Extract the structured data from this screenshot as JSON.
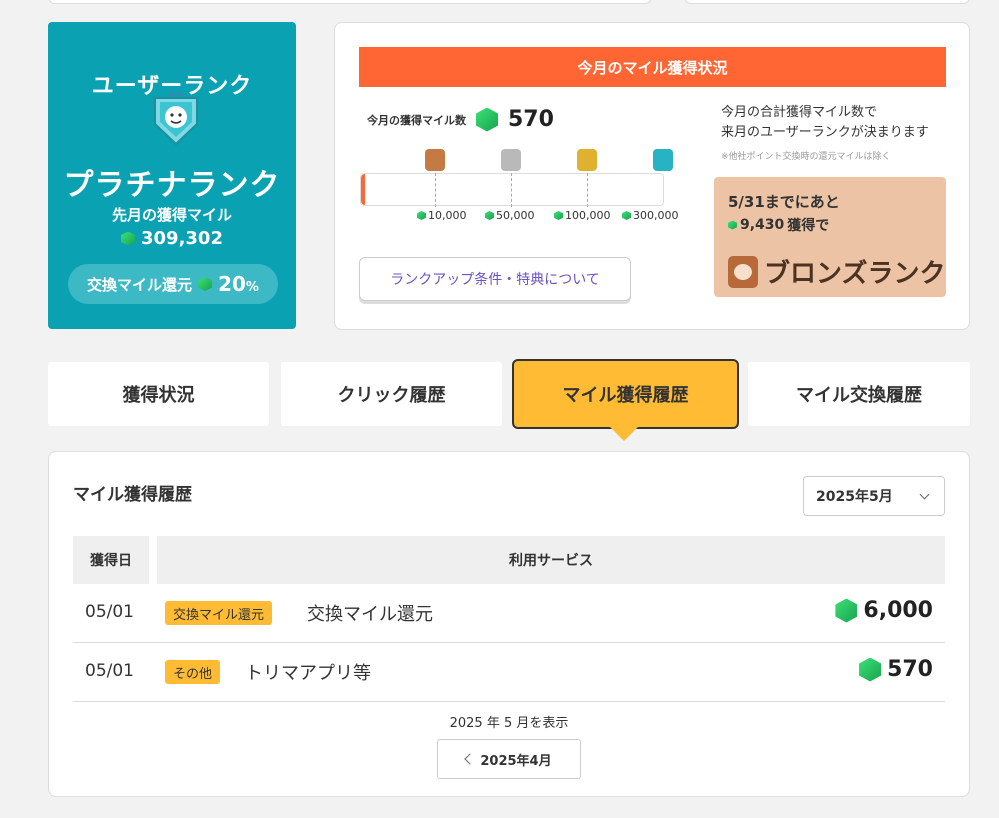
{
  "rank_card": {
    "title": "ユーザーランク",
    "rank_name": "プラチナランク",
    "last_month_label": "先月の獲得マイル",
    "last_month_miles": "309,302",
    "exchange_label": "交換マイル還元",
    "exchange_rate": "20",
    "exchange_unit": "%"
  },
  "status": {
    "header": "今月のマイル獲得状況",
    "current_label": "今月の獲得マイル数",
    "current_miles": "570",
    "progress_fraction": 0.01,
    "thresholds": [
      "10,000",
      "50,000",
      "100,000",
      "300,000"
    ],
    "info_line1": "今月の合計獲得マイル数で",
    "info_line2": "来月のユーザーランクが決まります",
    "note": "※他社ポイント交換時の還元マイルは除く",
    "next_line1": "5/31までにあと",
    "next_miles": "9,430",
    "next_suffix": "獲得で",
    "next_rank": "ブロンズランク",
    "rank_button": "ランクアップ条件・特典について"
  },
  "tabs": [
    {
      "label": "獲得状況"
    },
    {
      "label": "クリック履歴"
    },
    {
      "label": "マイル獲得履歴"
    },
    {
      "label": "マイル交換履歴"
    }
  ],
  "history": {
    "title": "マイル獲得履歴",
    "selected_month": "2025年5月",
    "col_date": "獲得日",
    "col_service": "利用サービス",
    "rows": [
      {
        "date": "05/01",
        "tag": "交換マイル還元",
        "service": "交換マイル還元",
        "amount": "6,000"
      },
      {
        "date": "05/01",
        "tag": "その他",
        "service": "トリマアプリ等",
        "amount": "570"
      }
    ],
    "showing": "2025 年 5 月を表示",
    "prev_month": "2025年4月"
  },
  "colors": {
    "rank_card_bg": "#0aa1b3",
    "status_header": "#ff6633",
    "active_tab": "#ffbb33",
    "next_rank_bg": "#ecc3a4",
    "link_purple": "#6c53c2"
  }
}
